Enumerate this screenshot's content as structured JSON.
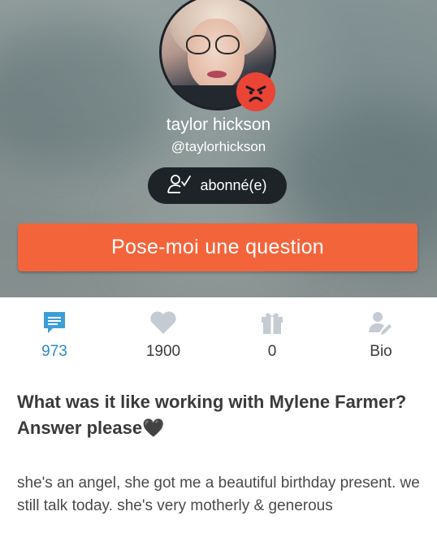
{
  "profile": {
    "name": "taylor hickson",
    "handle": "@taylorhickson",
    "avatar": "profile-photo",
    "mood_icon": "angry-face-icon",
    "mood_color": "#e94435"
  },
  "follow_button": {
    "label": "abonné(e)",
    "icon": "user-check-icon"
  },
  "ask_button": {
    "label": "Pose-moi une question",
    "color": "#f4643b"
  },
  "stats": [
    {
      "icon": "answers-bubble-icon",
      "value": "973",
      "active": true
    },
    {
      "icon": "heart-icon",
      "value": "1900",
      "active": false
    },
    {
      "icon": "gift-icon",
      "value": "0",
      "active": false
    },
    {
      "icon": "bio-edit-icon",
      "value": "Bio",
      "active": false
    }
  ],
  "post": {
    "question": "What was it like working with Mylene Farmer?",
    "question_line2": "Answer please",
    "question_emoji": "🖤",
    "answer": "she's an angel, she got me a beautiful birthday present. we still talk today. she's very motherly & generous"
  },
  "colors": {
    "accent": "#2b8cc4",
    "icon_gray": "#c4cbd3",
    "dark_button": "#1e2327"
  }
}
